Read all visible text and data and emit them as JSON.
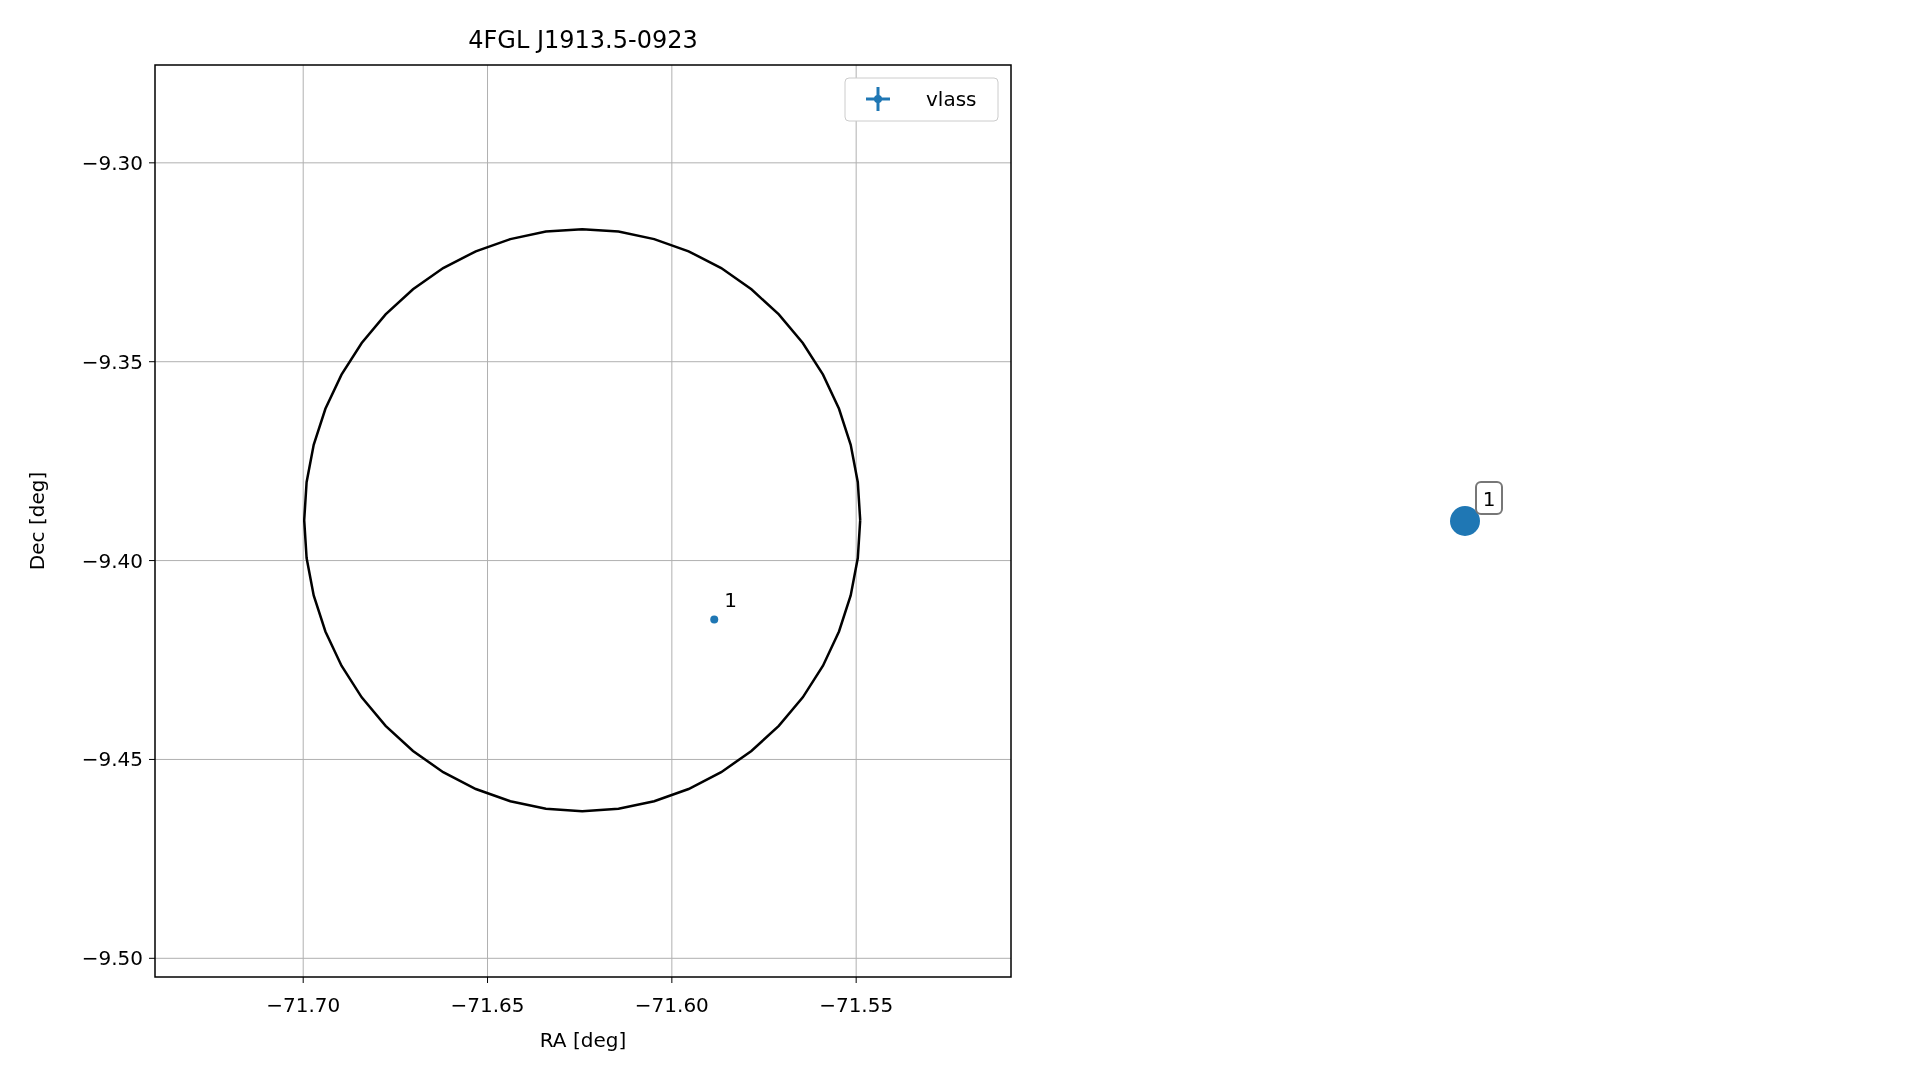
{
  "figure": {
    "chart_data": {
      "type": "scatter",
      "title": "4FGL J1913.5-0923",
      "xlabel": "RA [deg]",
      "ylabel": "Dec [deg]",
      "grid": true,
      "xlim": [
        -71.7402,
        -71.508
      ],
      "ylim": [
        -9.5047,
        -9.2754
      ],
      "xticks": [
        {
          "value": -71.7,
          "label": "−71.70"
        },
        {
          "value": -71.65,
          "label": "−71.65"
        },
        {
          "value": -71.6,
          "label": "−71.60"
        },
        {
          "value": -71.55,
          "label": "−71.55"
        }
      ],
      "yticks": [
        {
          "value": -9.3,
          "label": "−9.30"
        },
        {
          "value": -9.35,
          "label": "−9.35"
        },
        {
          "value": -9.4,
          "label": "−9.40"
        },
        {
          "value": -9.45,
          "label": "−9.45"
        },
        {
          "value": -9.5,
          "label": "−9.50"
        }
      ],
      "series": [
        {
          "name": "vlass",
          "color": "#1f77b4",
          "x": [
            -71.5885
          ],
          "values": [
            -9.4148
          ]
        }
      ],
      "annotations": [
        {
          "text": "1",
          "x": -71.5885,
          "y": -9.4148
        }
      ]
    },
    "side_marker": {
      "label": "1",
      "color": "#1f77b4"
    }
  }
}
